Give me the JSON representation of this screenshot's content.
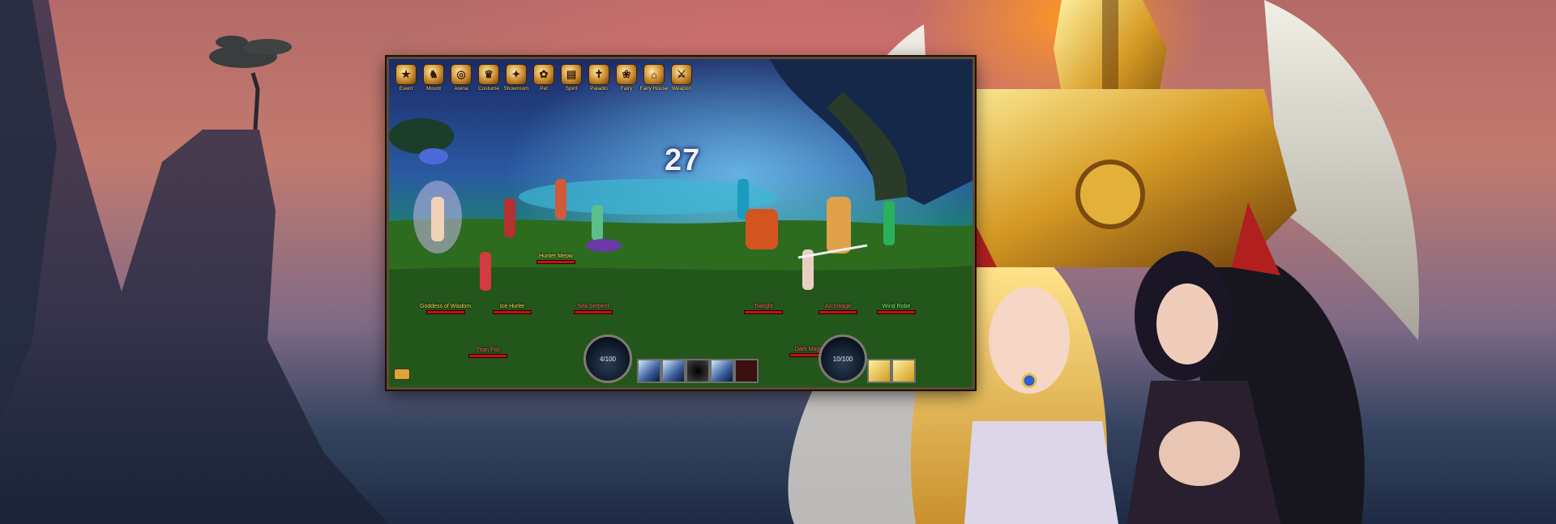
{
  "game": {
    "top_menu": [
      {
        "label": "Event",
        "icon": "event-icon"
      },
      {
        "label": "Mount",
        "icon": "mount-icon"
      },
      {
        "label": "Arena",
        "icon": "arena-icon"
      },
      {
        "label": "Costume",
        "icon": "costume-icon"
      },
      {
        "label": "Showroom",
        "icon": "showroom-icon"
      },
      {
        "label": "Pet",
        "icon": "pet-icon"
      },
      {
        "label": "Spirit",
        "icon": "spirit-icon"
      },
      {
        "label": "Paladin",
        "icon": "paladin-icon"
      },
      {
        "label": "Fairy",
        "icon": "fairy-icon"
      },
      {
        "label": "Fairy House",
        "icon": "fairy-house-icon"
      },
      {
        "label": "Weapon",
        "icon": "weapon-icon"
      }
    ],
    "turn_timer": "27",
    "allies": [
      {
        "name": "Goddess of Wisdom",
        "color": "yellow"
      },
      {
        "name": "Ice Hurler",
        "color": "yellow"
      },
      {
        "name": "Hunter Meow",
        "color": "yellow"
      },
      {
        "name": "Sea Serpent",
        "color": "red"
      },
      {
        "name": "Titan Fist",
        "color": "red"
      }
    ],
    "enemies": [
      {
        "name": "Twilight",
        "color": "red"
      },
      {
        "name": "Archmage",
        "color": "red"
      },
      {
        "name": "Wind Robe",
        "color": "green"
      },
      {
        "name": "Dark Mage",
        "color": "red"
      }
    ],
    "skill_bar": {
      "left_orb": "4/100",
      "right_orb": "10/100"
    }
  },
  "colors": {
    "accent_gold": "#ffd86b",
    "hp_red": "#c01414",
    "sky_orange": "#ff9628"
  }
}
